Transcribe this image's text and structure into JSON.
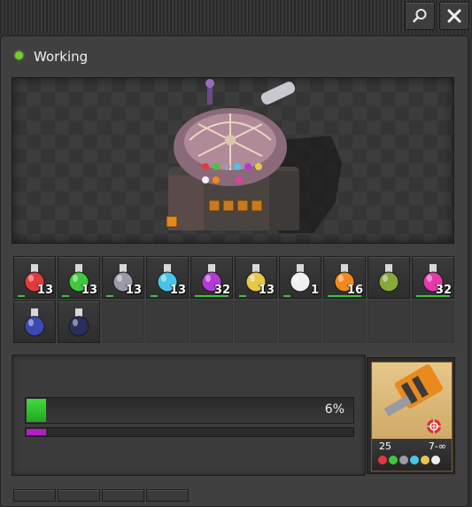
{
  "status": {
    "text": "Working",
    "color": "#6fd12c"
  },
  "inputs": [
    {
      "name": "automation-science-pack",
      "color": "#e23a3a",
      "count": "13"
    },
    {
      "name": "logistic-science-pack",
      "color": "#3fc83f",
      "count": "13"
    },
    {
      "name": "military-science-pack",
      "color": "#9a9aa8",
      "count": "13"
    },
    {
      "name": "chemical-science-pack",
      "color": "#4ac4e6",
      "count": "13"
    },
    {
      "name": "production-science-pack",
      "color": "#b23ad6",
      "count": "32"
    },
    {
      "name": "utility-science-pack",
      "color": "#e6c84a",
      "count": "13"
    },
    {
      "name": "space-science-pack",
      "color": "#f0f0f0",
      "count": "1"
    },
    {
      "name": "metallurgic-science-pack",
      "color": "#f08a1e",
      "count": "16"
    },
    {
      "name": "agricultural-science-pack",
      "color": "#8aa83a",
      "count": ""
    },
    {
      "name": "electromagnetic-science-pack",
      "color": "#e63aa8",
      "count": "32"
    },
    {
      "name": "cryogenic-science-pack",
      "color": "#3a4ab2",
      "count": ""
    },
    {
      "name": "promethium-science-pack",
      "color": "#2a2e5a",
      "count": ""
    }
  ],
  "progress": {
    "label": "6%",
    "value": 0.06,
    "color": "#2fc02f"
  },
  "bonus_progress": {
    "value": 0.06,
    "color": "#b21fc4"
  },
  "technology": {
    "name": "physical-projectile-damage",
    "count": "25",
    "levels": "7-∞"
  }
}
